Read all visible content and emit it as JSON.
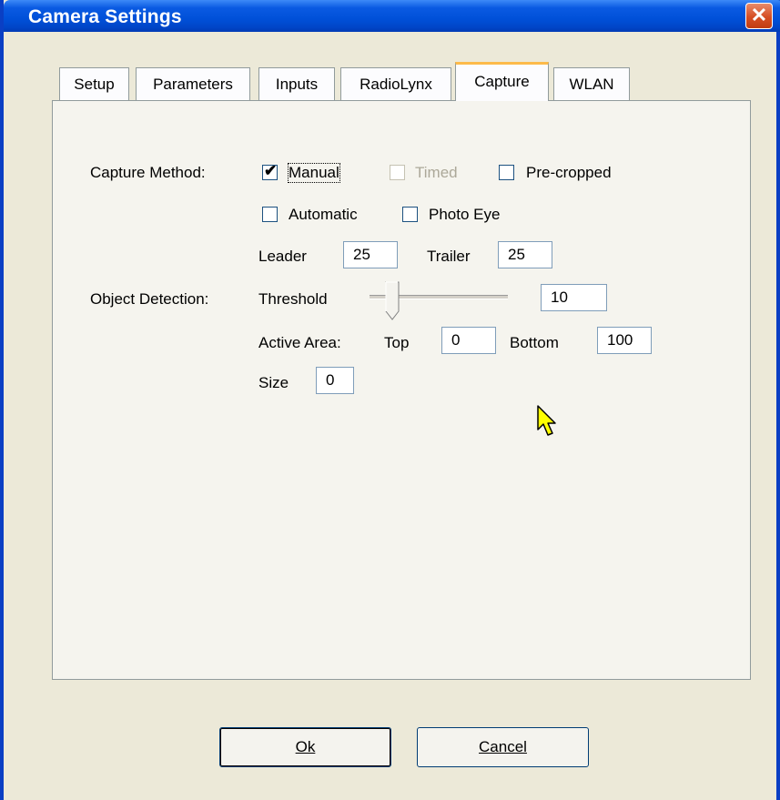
{
  "window": {
    "title": "Camera Settings",
    "close_label": "✕"
  },
  "tabs": [
    {
      "label": "Setup"
    },
    {
      "label": "Parameters"
    },
    {
      "label": "Inputs"
    },
    {
      "label": "RadioLynx"
    },
    {
      "label": "Capture",
      "active": true
    },
    {
      "label": "WLAN"
    }
  ],
  "capture": {
    "method_label": "Capture Method:",
    "manual": {
      "label": "Manual",
      "checked": true,
      "enabled": true
    },
    "timed": {
      "label": "Timed",
      "checked": false,
      "enabled": false
    },
    "precropped": {
      "label": "Pre-cropped",
      "checked": false,
      "enabled": true
    },
    "automatic": {
      "label": "Automatic",
      "checked": false,
      "enabled": true
    },
    "photo_eye": {
      "label": "Photo Eye",
      "checked": false,
      "enabled": true
    },
    "leader_label": "Leader",
    "leader_value": "25",
    "trailer_label": "Trailer",
    "trailer_value": "25"
  },
  "object_detection": {
    "label": "Object Detection:",
    "threshold_label": "Threshold",
    "threshold_value": "10",
    "active_area_label": "Active Area:",
    "top_label": "Top",
    "top_value": "0",
    "bottom_label": "Bottom",
    "bottom_value": "100",
    "size_label": "Size",
    "size_value": "0"
  },
  "buttons": {
    "ok_label": "Ok",
    "cancel_label": "Cancel"
  },
  "colors": {
    "titlebar": "#0050d8",
    "active_tab_highlight": "#fdba4a",
    "dialog_bg": "#ece9d8"
  }
}
